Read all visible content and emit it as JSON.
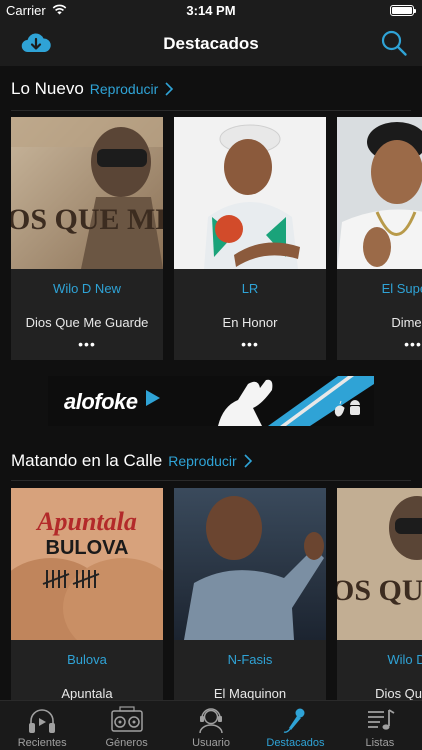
{
  "status_bar": {
    "carrier": "Carrier",
    "time": "3:14 PM"
  },
  "nav": {
    "title": "Destacados",
    "left_icon": "cloud-download-icon",
    "right_icon": "search-icon"
  },
  "sections": [
    {
      "title": "Lo Nuevo",
      "play_label": "Reproducir",
      "cards": [
        {
          "artist": "Wilo D New",
          "song": "Dios Que Me Guarde",
          "more": "•••"
        },
        {
          "artist": "LR",
          "song": "En Honor",
          "more": "•••"
        },
        {
          "artist": "El Super N",
          "song": "Dime C",
          "more": "•••"
        }
      ]
    },
    {
      "title": "Matando en la Calle",
      "play_label": "Reproducir",
      "cards": [
        {
          "artist": "Bulova",
          "song": "Apuntala",
          "more": "•••"
        },
        {
          "artist": "N-Fasis",
          "song": "El Maquinon",
          "more": "•••"
        },
        {
          "artist": "Wilo D N",
          "song": "Dios Que Me",
          "more": "•••"
        }
      ]
    }
  ],
  "artwork_text": {
    "dios_que_me_guarde": "OS QUE ME GUARDE",
    "apuntala": "Apuntala",
    "bulova": "BULOVA"
  },
  "banner": {
    "brand": "alofoke"
  },
  "tabs": [
    {
      "label": "Recientes",
      "icon": "headphones-icon",
      "active": false
    },
    {
      "label": "Géneros",
      "icon": "boombox-icon",
      "active": false
    },
    {
      "label": "Usuario",
      "icon": "user-headset-icon",
      "active": false
    },
    {
      "label": "Destacados",
      "icon": "microphone-icon",
      "active": true
    },
    {
      "label": "Listas",
      "icon": "playlist-icon",
      "active": false
    }
  ],
  "colors": {
    "accent": "#2fa3d6",
    "background": "#101010",
    "card": "#222222",
    "bar": "#1c1c1c"
  }
}
